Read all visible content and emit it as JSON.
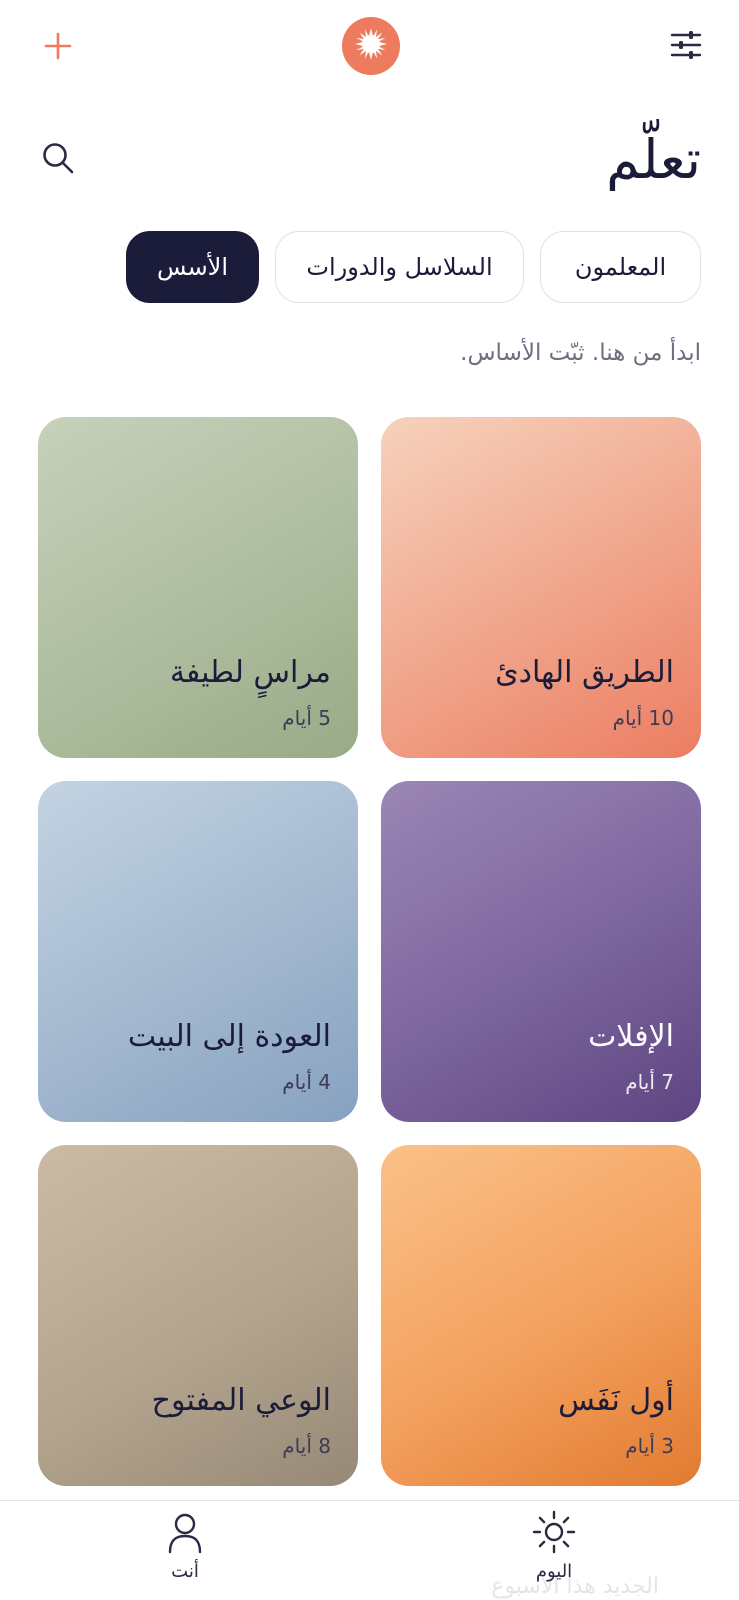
{
  "header": {
    "add_icon": "plus-icon",
    "logo_icon": "sun-burst-logo",
    "filter_icon": "sliders-icon",
    "accent_color": "#ee7b5d"
  },
  "page": {
    "title": "تعلّم",
    "search_icon": "search-icon",
    "subtitle": "ابدأ من هنا. ثبّت الأساس."
  },
  "tabs": [
    {
      "label": "الأسس",
      "active": true
    },
    {
      "label": "السلاسل والدورات",
      "active": false
    },
    {
      "label": "المعلمون",
      "active": false
    }
  ],
  "courses": [
    {
      "name": "الطريق الهادئ",
      "days": "10 أيام",
      "color": "#f0a48a"
    },
    {
      "name": "مراسٍ لطيفة",
      "days": "5 أيام",
      "color": "#aebd9f"
    },
    {
      "name": "الإفلات",
      "days": "7 أيام",
      "color": "#7c659d"
    },
    {
      "name": "العودة إلى البيت",
      "days": "4 أيام",
      "color": "#a3b8cf"
    },
    {
      "name": "أول نَفَس",
      "days": "3 أيام",
      "color": "#f3a05e"
    },
    {
      "name": "الوعي المفتوح",
      "days": "8 أيام",
      "color": "#b3a48e"
    }
  ],
  "bottom_nav": {
    "today_label": "اليوم",
    "today_icon": "sun-icon",
    "you_label": "أنت",
    "you_icon": "person-icon",
    "ghost_text": "الجديد هذا الأسبوع"
  }
}
